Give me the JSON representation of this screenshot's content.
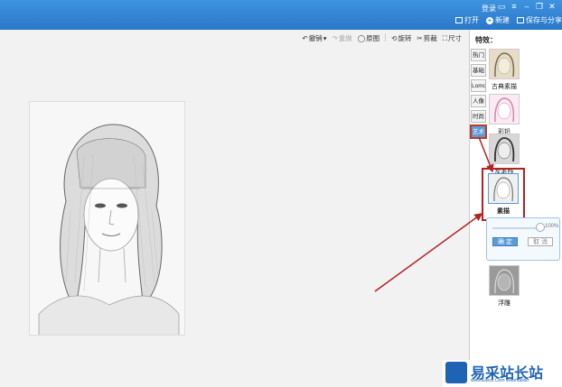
{
  "titlebar": {
    "login": "登录",
    "open_label": "打开",
    "new_label": "新建",
    "save_label": "保存与分享"
  },
  "toolbar": {
    "undo": "撤销",
    "redo": "重做",
    "original": "原图",
    "rotate": "旋转",
    "crop": "剪裁",
    "resize": "尺寸"
  },
  "panel": {
    "title": "特效：",
    "categories": [
      "热门",
      "基础",
      "Lomo",
      "人像",
      "时尚",
      "艺术"
    ],
    "active_category": "艺术",
    "effects": [
      {
        "label": "古典素描",
        "icon": "portrait-thumbnail"
      },
      {
        "label": "彩铅",
        "icon": "portrait-thumbnail"
      },
      {
        "label": "炭笔线",
        "icon": "portrait-thumbnail"
      },
      {
        "label": "素描",
        "icon": "portrait-thumbnail"
      },
      {
        "label": "浮雕",
        "icon": "portrait-thumbnail"
      }
    ],
    "selected_effect": "素描",
    "intensity_label": "100%",
    "intensity_value": 1.0,
    "confirm_label": "确 定",
    "cancel_label": "取 消"
  },
  "watermark": {
    "title": "易采站长站",
    "subtitle": "www.Easck.Com Webmaster"
  },
  "colors": {
    "titlebar": "#2a78c8",
    "accent": "#5b9bd8",
    "highlight": "#b22222"
  }
}
